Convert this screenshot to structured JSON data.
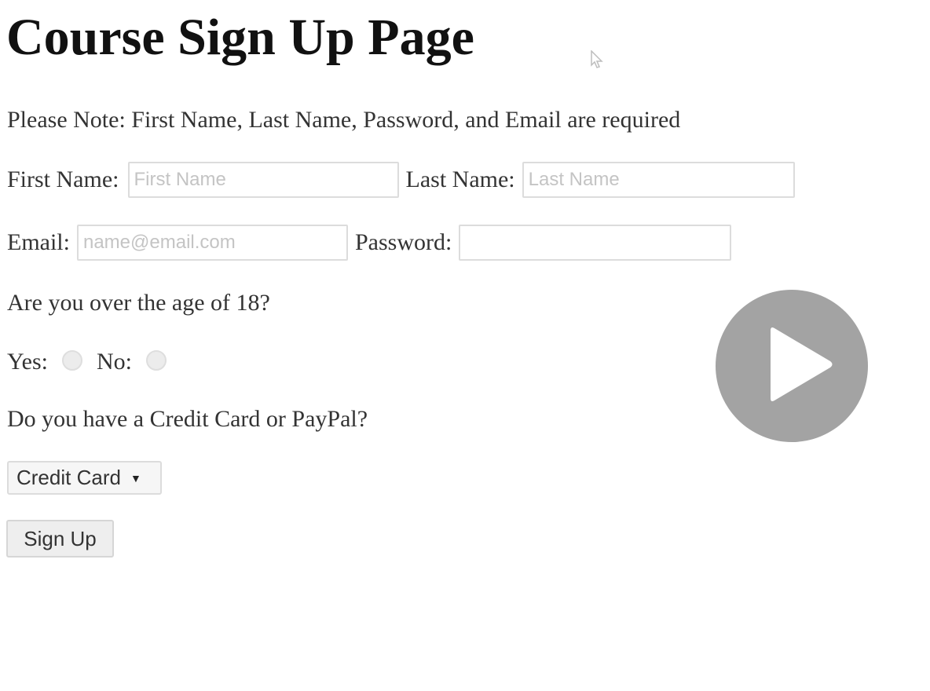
{
  "page": {
    "title": "Course Sign Up Page",
    "note": "Please Note: First Name, Last Name, Password, and Email are required"
  },
  "form": {
    "first_name_label": "First Name:",
    "first_name_placeholder": "First Name",
    "first_name_value": "",
    "last_name_label": "Last Name:",
    "last_name_placeholder": "Last Name",
    "last_name_value": "",
    "email_label": "Email:",
    "email_placeholder": "name@email.com",
    "email_value": "",
    "password_label": "Password:",
    "password_value": "",
    "age_question": "Are you over the age of 18?",
    "yes_label": "Yes:",
    "no_label": "No:",
    "payment_question": "Do you have a Credit Card or PayPal?",
    "payment_selected": "Credit Card",
    "submit_label": "Sign Up"
  },
  "overlay": {
    "play_icon": "play-icon",
    "cursor_icon": "pointer-cursor-icon"
  },
  "colors": {
    "play_button": "#a3a3a3",
    "input_border": "#dcdcdc",
    "placeholder": "#c4c4c4"
  }
}
